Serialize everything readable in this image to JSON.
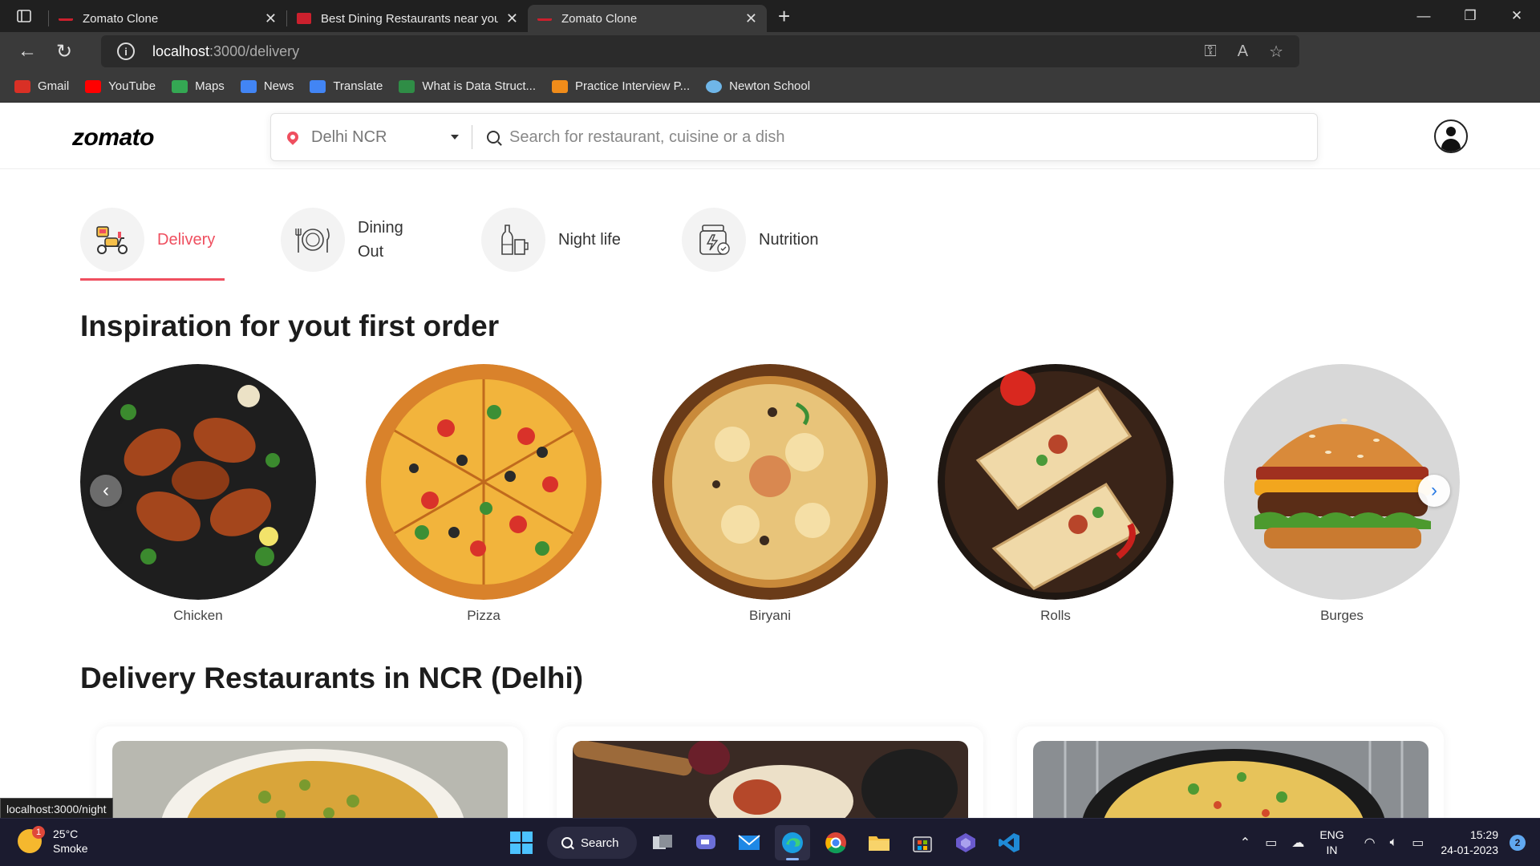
{
  "browser": {
    "tabs": [
      {
        "title": "Zomato Clone",
        "active": false
      },
      {
        "title": "Best Dining Restaurants near you",
        "active": false
      },
      {
        "title": "Zomato Clone",
        "active": true
      }
    ],
    "url_host": "localhost",
    "url_path": ":3000/delivery",
    "bookmarks": [
      {
        "label": "Gmail",
        "icon": "gmail-icon",
        "color": "#d93025"
      },
      {
        "label": "YouTube",
        "icon": "youtube-icon",
        "color": "#ff0000"
      },
      {
        "label": "Maps",
        "icon": "maps-icon",
        "color": "#34a853"
      },
      {
        "label": "News",
        "icon": "news-icon",
        "color": "#4285f4"
      },
      {
        "label": "Translate",
        "icon": "translate-icon",
        "color": "#4285f4"
      },
      {
        "label": "What is Data Struct...",
        "icon": "gfg-icon",
        "color": "#2f8d46"
      },
      {
        "label": "Practice Interview P...",
        "icon": "practice-icon",
        "color": "#f08c1a"
      },
      {
        "label": "Newton School",
        "icon": "newton-icon",
        "color": "#6fb6e8"
      }
    ],
    "status_url": "localhost:3000/night"
  },
  "header": {
    "logo": "zomato",
    "location": "Delhi NCR",
    "search_placeholder": "Search for restaurant, cuisine or a dish"
  },
  "category_tabs": [
    {
      "label": "Delivery",
      "icon": "scooter-icon",
      "active": true
    },
    {
      "label": "Dining Out",
      "icon": "plate-icon",
      "active": false
    },
    {
      "label": "Night life",
      "icon": "bottles-icon",
      "active": false
    },
    {
      "label": "Nutrition",
      "icon": "supplement-jar-icon",
      "active": false
    }
  ],
  "inspiration": {
    "title": "Inspiration for yout first order",
    "items": [
      {
        "label": "Chicken"
      },
      {
        "label": "Pizza"
      },
      {
        "label": "Biryani"
      },
      {
        "label": "Rolls"
      },
      {
        "label": "Burges"
      }
    ]
  },
  "restaurants": {
    "title": "Delivery Restaurants in NCR (Delhi)"
  },
  "taskbar": {
    "weather_temp": "25°C",
    "weather_desc": "Smoke",
    "weather_badge": "1",
    "search_label": "Search",
    "lang_1": "ENG",
    "lang_2": "IN",
    "time": "15:29",
    "date": "24-01-2023",
    "notifications": "2"
  },
  "colors": {
    "accent": "#ef4f5f",
    "chrome_dark": "#202020",
    "taskbar": "#1b1b2f"
  }
}
